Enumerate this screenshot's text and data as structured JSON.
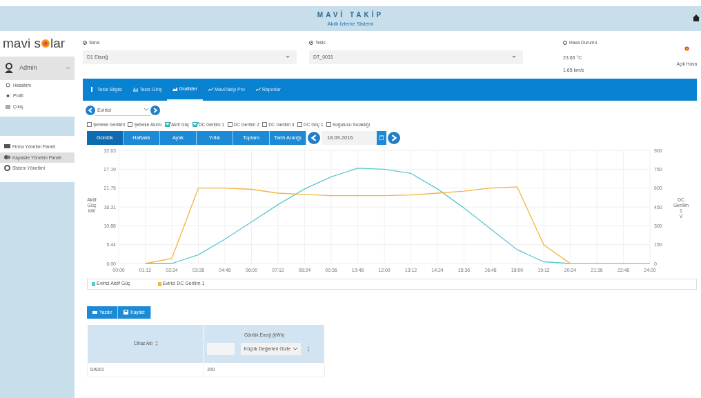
{
  "header": {
    "title": "MAVİ TAKİP",
    "subtitle": "Akıllı İzleme Sistemi"
  },
  "logo": {
    "text_left": "mavi s",
    "text_right": "lar"
  },
  "user": {
    "name": "Admin"
  },
  "menu": [
    {
      "label": "Hesabım"
    },
    {
      "label": "Profil"
    },
    {
      "label": "Çıkış"
    }
  ],
  "panels": [
    {
      "label": "Firma Yönetim Paneli",
      "selected": false
    },
    {
      "label": "Kapasite Yönetim Paneli",
      "selected": true
    },
    {
      "label": "Sistem Yönetimi",
      "selected": false
    }
  ],
  "saha": {
    "label": "Saha",
    "value": "D1 Elazığ"
  },
  "tesis": {
    "label": "Tesis",
    "value": "DT_0031"
  },
  "weather": {
    "label": "Hava Durumu",
    "temperature": "23.65 °C",
    "wind": "1.65 km/s",
    "condition": "Açık Hava"
  },
  "tabs": [
    {
      "label": "Tesis Bilgisi",
      "selected": false
    },
    {
      "label": "Tesis Giriş",
      "selected": false
    },
    {
      "label": "Grafikler",
      "selected": true
    },
    {
      "label": "MaviTakip Pro",
      "selected": false
    },
    {
      "label": "Raporlar",
      "selected": false
    }
  ],
  "device_select": {
    "value": "Evirici"
  },
  "options": [
    {
      "label": "Şebeke Gerilimi",
      "checked": false
    },
    {
      "label": "Şebeke Akımı",
      "checked": false
    },
    {
      "label": "Aktif Güç",
      "checked": true
    },
    {
      "label": "DC Gerilim 1",
      "checked": true
    },
    {
      "label": "DC Gerilim 2",
      "checked": false
    },
    {
      "label": "DC Gerilim 3",
      "checked": false
    },
    {
      "label": "DC Güç 1",
      "checked": false
    },
    {
      "label": "Soğutucu Sıcaklığı",
      "checked": false
    }
  ],
  "periods": [
    {
      "label": "Günlük",
      "selected": true
    },
    {
      "label": "Haftalık",
      "selected": false
    },
    {
      "label": "Aylık",
      "selected": false
    },
    {
      "label": "Yıllık",
      "selected": false
    },
    {
      "label": "Toplam",
      "selected": false
    },
    {
      "label": "Tarih Aralığı",
      "selected": false
    }
  ],
  "date": {
    "value": "18.09.2016"
  },
  "chart": {
    "chart_data": {
      "type": "line",
      "grid": true,
      "ylabel": "Aktif Güç kW",
      "y2label": "DC Gerilim 1 V",
      "x": [
        "00:00",
        "01:12",
        "02:24",
        "03:36",
        "04:48",
        "06:00",
        "07:12",
        "08:24",
        "09:36",
        "10:48",
        "12:00",
        "13:12",
        "14:24",
        "15:36",
        "16:48",
        "18:00",
        "19:12",
        "20:24",
        "21:36",
        "22:48",
        "24:00"
      ],
      "ylim": [
        0,
        32.63
      ],
      "yticks": [
        {
          "value": 0,
          "label": "0.00"
        },
        {
          "value": 5.44,
          "label": "5.44"
        },
        {
          "value": 10.88,
          "label": "10.88"
        },
        {
          "value": 16.31,
          "label": "16.31"
        },
        {
          "value": 21.75,
          "label": "21.75"
        },
        {
          "value": 27.19,
          "label": "27.19"
        },
        {
          "value": 32.63,
          "label": "32.63"
        }
      ],
      "y2lim": [
        0,
        900
      ],
      "y2ticks": [
        0,
        150,
        300,
        450,
        600,
        750,
        900
      ],
      "series": [
        {
          "name": "Evirici Aktif Güç",
          "color": "#5bc8d0",
          "values": [
            null,
            0,
            0,
            2.5,
            7,
            12,
            17,
            21.5,
            25,
            27.5,
            27.2,
            26,
            21.5,
            16,
            10,
            4,
            0.5,
            0,
            null,
            null,
            null
          ]
        },
        {
          "name": "Evirici DC Gerilim 1",
          "color": "#f3b53d",
          "axis": "y2",
          "values": [
            null,
            0,
            40,
            600,
            600,
            590,
            560,
            550,
            540,
            540,
            540,
            545,
            560,
            575,
            600,
            610,
            150,
            0,
            0,
            0,
            0
          ]
        }
      ]
    }
  },
  "actions": [
    {
      "label": "Yazdır",
      "kind": "print"
    },
    {
      "label": "Kaydet",
      "kind": "save"
    }
  ],
  "table": {
    "columns": [
      {
        "label": "Cihaz Adı",
        "filter": false
      },
      {
        "label": "Günlük Enerji (kWh)",
        "filter": true
      }
    ],
    "filter_select": {
      "value": "Küçük Değerleri Gizle"
    },
    "rows": [
      [
        "DA001",
        "200"
      ]
    ]
  }
}
